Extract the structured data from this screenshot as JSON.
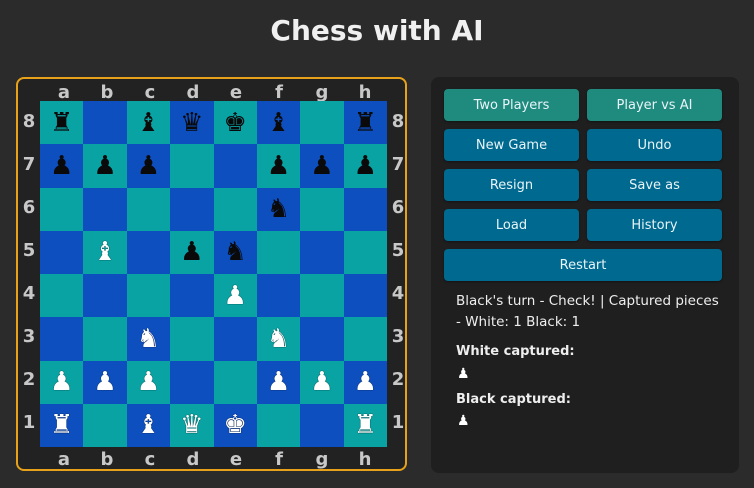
{
  "title": "Chess with AI",
  "files": [
    "a",
    "b",
    "c",
    "d",
    "e",
    "f",
    "g",
    "h"
  ],
  "ranks": [
    "8",
    "7",
    "6",
    "5",
    "4",
    "3",
    "2",
    "1"
  ],
  "board": [
    [
      {
        "g": "♜",
        "c": "black"
      },
      {
        "g": "",
        "c": ""
      },
      {
        "g": "♝",
        "c": "black"
      },
      {
        "g": "♛",
        "c": "black"
      },
      {
        "g": "♚",
        "c": "black"
      },
      {
        "g": "♝",
        "c": "black"
      },
      {
        "g": "",
        "c": ""
      },
      {
        "g": "♜",
        "c": "black"
      }
    ],
    [
      {
        "g": "♟",
        "c": "black"
      },
      {
        "g": "♟",
        "c": "black"
      },
      {
        "g": "♟",
        "c": "black"
      },
      {
        "g": "",
        "c": ""
      },
      {
        "g": "",
        "c": ""
      },
      {
        "g": "♟",
        "c": "black"
      },
      {
        "g": "♟",
        "c": "black"
      },
      {
        "g": "♟",
        "c": "black"
      }
    ],
    [
      {
        "g": "",
        "c": ""
      },
      {
        "g": "",
        "c": ""
      },
      {
        "g": "",
        "c": ""
      },
      {
        "g": "",
        "c": ""
      },
      {
        "g": "",
        "c": ""
      },
      {
        "g": "♞",
        "c": "black"
      },
      {
        "g": "",
        "c": ""
      },
      {
        "g": "",
        "c": ""
      }
    ],
    [
      {
        "g": "",
        "c": ""
      },
      {
        "g": "♝",
        "c": "white"
      },
      {
        "g": "",
        "c": ""
      },
      {
        "g": "♟",
        "c": "black"
      },
      {
        "g": "♞",
        "c": "black"
      },
      {
        "g": "",
        "c": ""
      },
      {
        "g": "",
        "c": ""
      },
      {
        "g": "",
        "c": ""
      }
    ],
    [
      {
        "g": "",
        "c": ""
      },
      {
        "g": "",
        "c": ""
      },
      {
        "g": "",
        "c": ""
      },
      {
        "g": "",
        "c": ""
      },
      {
        "g": "♟",
        "c": "white"
      },
      {
        "g": "",
        "c": ""
      },
      {
        "g": "",
        "c": ""
      },
      {
        "g": "",
        "c": ""
      }
    ],
    [
      {
        "g": "",
        "c": ""
      },
      {
        "g": "",
        "c": ""
      },
      {
        "g": "♞",
        "c": "white"
      },
      {
        "g": "",
        "c": ""
      },
      {
        "g": "",
        "c": ""
      },
      {
        "g": "♞",
        "c": "white"
      },
      {
        "g": "",
        "c": ""
      },
      {
        "g": "",
        "c": ""
      }
    ],
    [
      {
        "g": "♟",
        "c": "white"
      },
      {
        "g": "♟",
        "c": "white"
      },
      {
        "g": "♟",
        "c": "white"
      },
      {
        "g": "",
        "c": ""
      },
      {
        "g": "",
        "c": ""
      },
      {
        "g": "♟",
        "c": "white"
      },
      {
        "g": "♟",
        "c": "white"
      },
      {
        "g": "♟",
        "c": "white"
      }
    ],
    [
      {
        "g": "♜",
        "c": "white"
      },
      {
        "g": "",
        "c": ""
      },
      {
        "g": "♝",
        "c": "white"
      },
      {
        "g": "♛",
        "c": "white"
      },
      {
        "g": "♚",
        "c": "white"
      },
      {
        "g": "",
        "c": ""
      },
      {
        "g": "",
        "c": ""
      },
      {
        "g": "♜",
        "c": "white"
      }
    ]
  ],
  "buttons": {
    "two_players": "Two Players",
    "player_vs_ai": "Player vs AI",
    "new_game": "New Game",
    "undo": "Undo",
    "resign": "Resign",
    "save_as": "Save as",
    "load": "Load",
    "history": "History",
    "restart": "Restart"
  },
  "status": "Black's turn - Check! | Captured pieces - White: 1 Black: 1",
  "white_captured": {
    "label": "White captured:",
    "piece": "♟"
  },
  "black_captured": {
    "label": "Black captured:",
    "piece": "♟"
  },
  "colors": {
    "light_square": "#0aa3a3",
    "dark_square": "#0e4fc0",
    "frame": "#e8a21a",
    "button": "#00698f",
    "mode_button": "#1f8a7e"
  }
}
